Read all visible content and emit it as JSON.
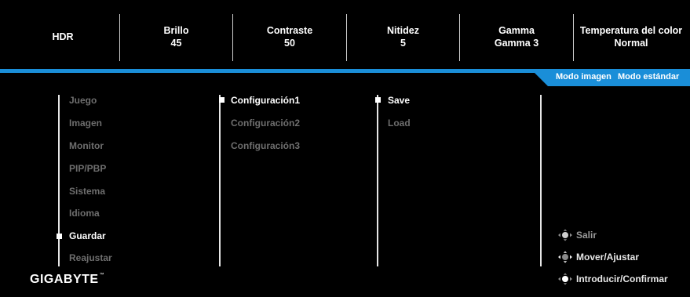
{
  "header": {
    "items": [
      {
        "label": "HDR",
        "value": ""
      },
      {
        "label": "Brillo",
        "value": "45"
      },
      {
        "label": "Contraste",
        "value": "50"
      },
      {
        "label": "Nitidez",
        "value": "5"
      },
      {
        "label": "Gamma",
        "value": "Gamma 3"
      },
      {
        "label": "Temperatura del color",
        "value": "Normal"
      }
    ]
  },
  "status": {
    "picture_mode_label": "Modo imagen",
    "picture_mode_value": "Modo estándar"
  },
  "menu": {
    "main_items": [
      "Juego",
      "Imagen",
      "Monitor",
      "PIP/PBP",
      "Sistema",
      "Idioma",
      "Guardar",
      "Reajustar"
    ],
    "selected_main": "Guardar",
    "config_items": [
      "Configuración1",
      "Configuración2",
      "Configuración3"
    ],
    "selected_config": "Configuración1",
    "action_items": [
      "Save",
      "Load"
    ],
    "selected_action": "Save"
  },
  "legend": {
    "exit": "Salir",
    "move_adjust": "Mover/Ajustar",
    "enter_confirm": "Introducir/Confirmar"
  },
  "brand": {
    "logo_text": "GIGABYTE",
    "trademark": "™"
  },
  "colors": {
    "accent": "#1a8ed8",
    "background": "#000000",
    "active_text": "#ffffff",
    "inactive_text": "#6e6e6e"
  },
  "icons": {
    "marker": "square-bullet-icon",
    "joystick": "joystick-icon"
  }
}
